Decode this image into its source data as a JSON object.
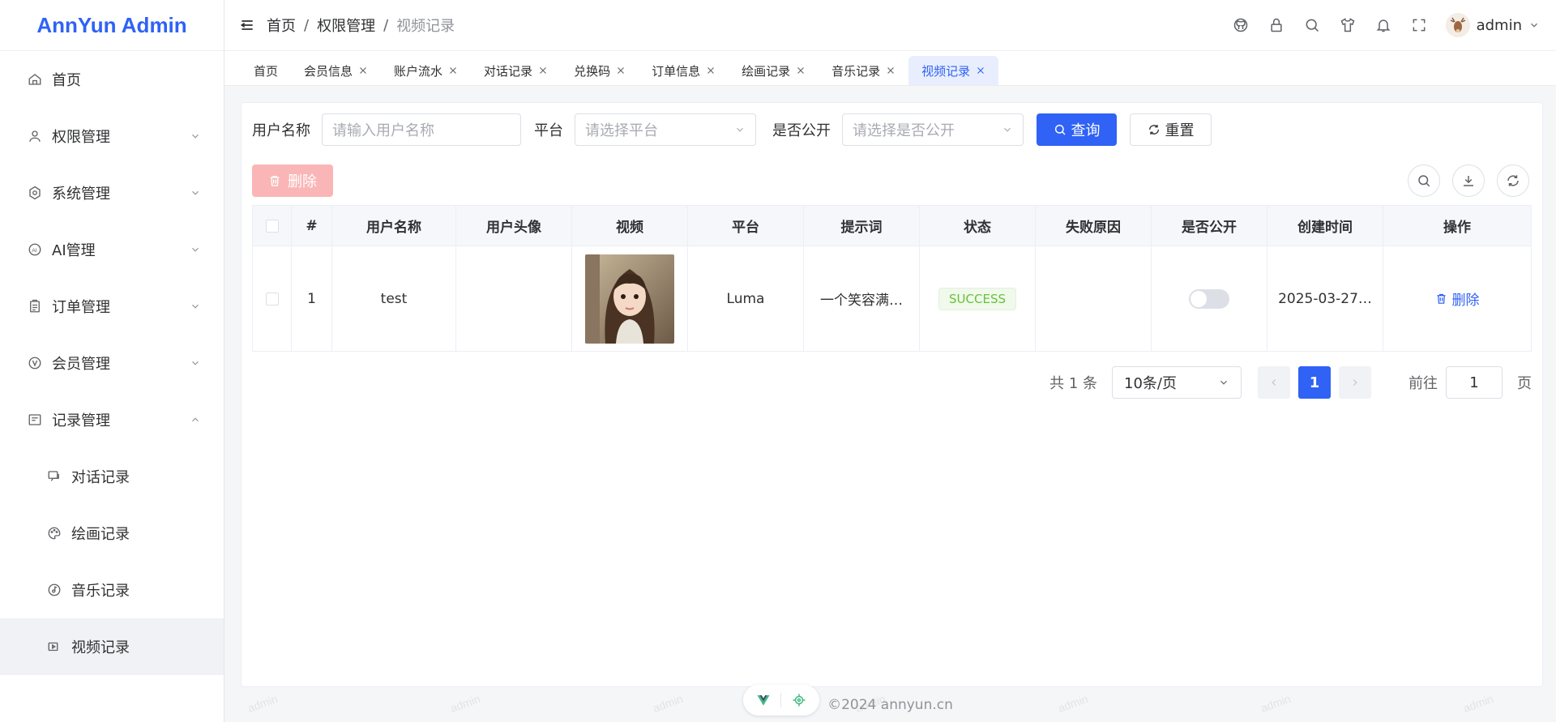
{
  "app": {
    "title": "AnnYun Admin"
  },
  "sidebar": {
    "items": [
      {
        "label": "首页",
        "icon": "home-icon",
        "expandable": false
      },
      {
        "label": "权限管理",
        "icon": "user-icon",
        "expandable": true
      },
      {
        "label": "系统管理",
        "icon": "settings-icon",
        "expandable": true
      },
      {
        "label": "AI管理",
        "icon": "ai-icon",
        "expandable": true
      },
      {
        "label": "订单管理",
        "icon": "clipboard-icon",
        "expandable": true
      },
      {
        "label": "会员管理",
        "icon": "vip-icon",
        "expandable": true
      },
      {
        "label": "记录管理",
        "icon": "records-icon",
        "expandable": true,
        "expanded": true
      }
    ],
    "sub_items": [
      {
        "label": "对话记录",
        "icon": "chat-icon"
      },
      {
        "label": "绘画记录",
        "icon": "palette-icon"
      },
      {
        "label": "音乐记录",
        "icon": "music-icon"
      },
      {
        "label": "视频记录",
        "icon": "video-icon",
        "active": true
      }
    ]
  },
  "header": {
    "breadcrumb": [
      "首页",
      "权限管理",
      "视频记录"
    ],
    "username": "admin",
    "icons": [
      "github-icon",
      "lock-icon",
      "search-icon",
      "shirt-icon",
      "bell-icon",
      "fullscreen-icon"
    ]
  },
  "tabs": [
    {
      "label": "首页",
      "closable": false
    },
    {
      "label": "会员信息",
      "closable": true
    },
    {
      "label": "账户流水",
      "closable": true
    },
    {
      "label": "对话记录",
      "closable": true
    },
    {
      "label": "兑换码",
      "closable": true
    },
    {
      "label": "订单信息",
      "closable": true
    },
    {
      "label": "绘画记录",
      "closable": true
    },
    {
      "label": "音乐记录",
      "closable": true
    },
    {
      "label": "视频记录",
      "closable": true,
      "active": true
    }
  ],
  "search": {
    "username_label": "用户名称",
    "username_placeholder": "请输入用户名称",
    "platform_label": "平台",
    "platform_placeholder": "请选择平台",
    "public_label": "是否公开",
    "public_placeholder": "请选择是否公开",
    "query_button": "查询",
    "reset_button": "重置"
  },
  "toolbar": {
    "delete_button": "删除"
  },
  "table": {
    "columns": [
      "#",
      "用户名称",
      "用户头像",
      "视频",
      "平台",
      "提示词",
      "状态",
      "失败原因",
      "是否公开",
      "创建时间",
      "操作"
    ],
    "rows": [
      {
        "index": "1",
        "username": "test",
        "avatar": "",
        "platform": "Luma",
        "prompt": "一个笑容满…",
        "status": "SUCCESS",
        "fail_reason": "",
        "is_public": false,
        "created_at": "2025-03-27…",
        "action": "删除"
      }
    ]
  },
  "pagination": {
    "total_text": "共 1 条",
    "page_size": "10条/页",
    "current_page": "1",
    "goto_label": "前往",
    "goto_value": "1",
    "goto_unit": "页"
  },
  "footer": {
    "copyright": "©2024 annyun.cn"
  },
  "watermark": "admin",
  "colors": {
    "primary": "#2f62f5",
    "danger_light": "#fab6b6",
    "success": "#67c23a"
  }
}
